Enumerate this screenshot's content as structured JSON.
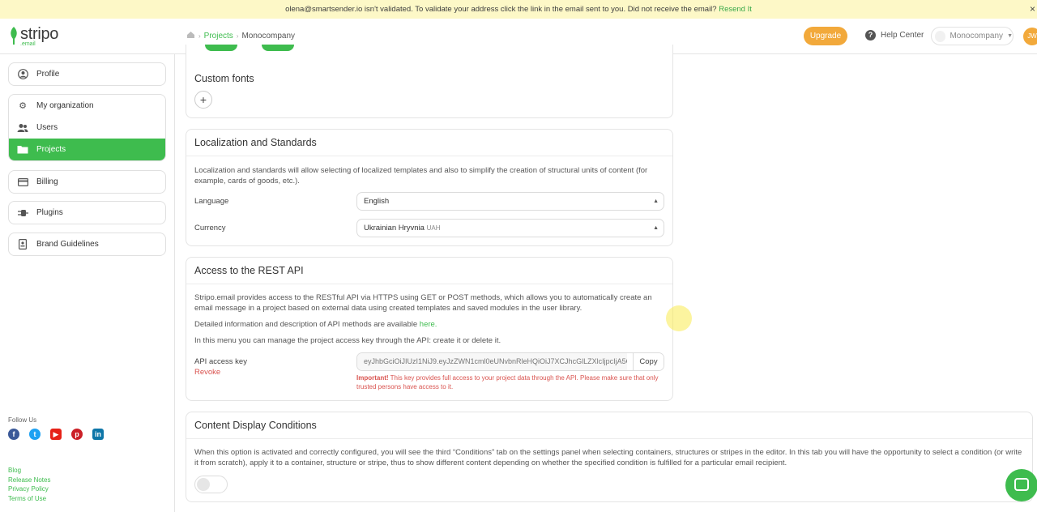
{
  "notice": {
    "text": "olena@smartsender.io isn't validated. To validate your address click the link in the email sent to you. Did not receive the email?",
    "link": "Resend It",
    "close": "×"
  },
  "header": {
    "logo_word": "stripo",
    "logo_sub": ".email",
    "breadcrumbs": [
      "Projects",
      "Monocompany"
    ],
    "upgrade": "Upgrade",
    "help": "Help Center",
    "org": "Monocompany",
    "avatar": "JW"
  },
  "sidebar": {
    "profile": "Profile",
    "my_org": "My organization",
    "users": "Users",
    "projects": "Projects",
    "billing": "Billing",
    "plugins": "Plugins",
    "brand": "Brand Guidelines",
    "follow": "Follow Us",
    "links": [
      "Blog",
      "Release Notes",
      "Privacy Policy",
      "Terms of Use"
    ]
  },
  "fonts": {
    "title": "Custom fonts",
    "add": "+"
  },
  "localization": {
    "title": "Localization and Standards",
    "desc": "Localization and standards will allow selecting of localized templates and also to simplify the creation of structural units of content (for example, cards of goods, etc.).",
    "language_label": "Language",
    "language_value": "English",
    "currency_label": "Currency",
    "currency_value": "Ukrainian Hryvnia",
    "currency_code": "UAH"
  },
  "api": {
    "title": "Access to the REST API",
    "desc": "Stripo.email provides access to the RESTful API via HTTPS using GET or POST methods, which allows you to automatically create an email message in a project based on external data using created templates and saved modules in the user library.",
    "info_text": "Detailed information and description of API methods are available",
    "info_link": "here.",
    "manage": "In this menu you can manage the project access key through the API: create it or delete it.",
    "key_label": "API access key",
    "key_value": "eyJhbGciOiJIUzI1NiJ9.eyJzZWN1cml0eUNvbnRleHQiOiJ7XCJhcGlLZXlcIjpcIjA5C",
    "copy": "Copy",
    "revoke": "Revoke",
    "warn_bold": "Important!",
    "warn_text": "This key provides full access to your project data through the API. Please make sure that only trusted persons have access to it."
  },
  "conditions": {
    "title": "Content Display Conditions",
    "desc": "When this option is activated and correctly configured, you will see the third “Conditions” tab on the settings panel when selecting containers, structures or stripes in the editor. In this tab you will have the opportunity to select a condition (or write it from scratch), apply it to a container, structure or stripe, thus to show different content depending on whether the specified condition is fulfilled for a particular email recipient."
  },
  "colors": {
    "accent": "#3ebc4e",
    "upgrade": "#f2a93b",
    "warning": "#d9534f",
    "notice_bg": "#fdf8c7"
  }
}
